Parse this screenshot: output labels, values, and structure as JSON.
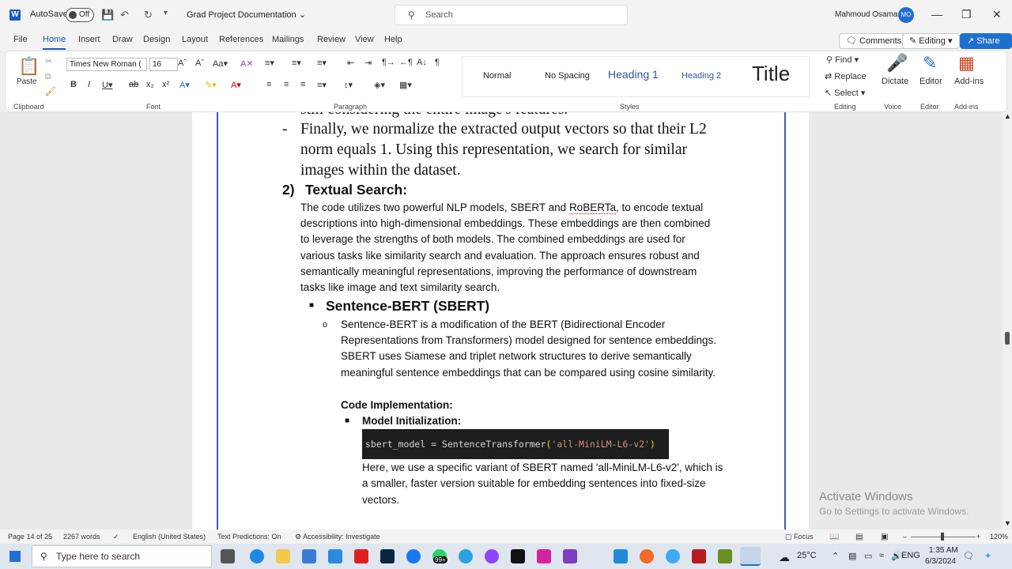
{
  "titlebar": {
    "autosave": "AutoSave",
    "autosave_state": "Off",
    "doc_title": "Grad Project Documentation",
    "search_placeholder": "Search",
    "user_name": "Mahmoud Osama",
    "user_initials": "MO"
  },
  "menu": {
    "tabs": [
      "File",
      "Home",
      "Insert",
      "Draw",
      "Design",
      "Layout",
      "References",
      "Mailings",
      "Review",
      "View",
      "Help"
    ],
    "comments": "Comments",
    "editing": "Editing",
    "share": "Share"
  },
  "ribbon": {
    "paste": "Paste",
    "font_name": "Times New Roman (",
    "font_size": "16",
    "styles": [
      "Normal",
      "No Spacing",
      "Heading 1",
      "Heading 2",
      "Title"
    ],
    "find": "Find",
    "replace": "Replace",
    "select": "Select",
    "dictate": "Dictate",
    "editor": "Editor",
    "addins": "Add-ins",
    "groups": {
      "clipboard": "Clipboard",
      "font": "Font",
      "paragraph": "Paragraph",
      "styles": "Styles",
      "editing": "Editing",
      "voice": "Voice",
      "editor": "Editor",
      "addins": "Add-ins"
    }
  },
  "document": {
    "partial_line": "still considering the entire image's features.",
    "bullet_dash": "-",
    "finally_para": [
      "Finally, we normalize the extracted output vectors so that their L2",
      "norm equals 1. Using this representation, we search for similar",
      "images within the dataset."
    ],
    "heading_num": "2)",
    "heading": "Textual Search:",
    "intro_pre": "The code utilizes two powerful NLP models, SBERT and ",
    "intro_roberta": "RoBERTa",
    "intro_post": ", to encode textual",
    "intro_lines": [
      "descriptions into high-dimensional embeddings. These embeddings are then combined",
      "to leverage the strengths of both models. The combined embeddings are used for",
      "various tasks like similarity search and evaluation. The approach ensures robust and",
      "semantically meaningful representations, improving the performance of downstream",
      "tasks like image and text similarity search."
    ],
    "sbert_heading": "Sentence-BERT (SBERT)",
    "sbert_lines": [
      "Sentence-BERT is a modification of the BERT (Bidirectional Encoder",
      "Representations from Transformers) model designed for sentence embeddings.",
      "SBERT uses Siamese and triplet network structures to derive semantically",
      "meaningful sentence embeddings that can be compared using cosine similarity."
    ],
    "code_impl": "Code Implementation:",
    "model_init": "Model Initialization:",
    "code_pre": "sbert_model = SentenceTransformer",
    "code_open": "(",
    "code_str": "'all-MiniLM-L6-v2'",
    "code_close": ")",
    "here_lines": [
      "Here, we use a specific variant of SBERT named 'all-MiniLM-L6-v2', which is",
      "a smaller, faster version suitable for embedding sentences into fixed-size",
      "vectors."
    ]
  },
  "watermark": {
    "line1": "Activate Windows",
    "line2": "Go to Settings to activate Windows."
  },
  "status": {
    "page": "Page 14 of 25",
    "words": "2267 words",
    "language": "English (United States)",
    "predictions": "Text Predictions: On",
    "accessibility": "Accessibility: Investigate",
    "focus": "Focus",
    "zoom": "120%"
  },
  "taskbar": {
    "search": "Type here to search",
    "badge": "99+",
    "temp": "25°C",
    "lang": "ENG",
    "time": "1:35 AM",
    "date": "6/3/2024"
  }
}
